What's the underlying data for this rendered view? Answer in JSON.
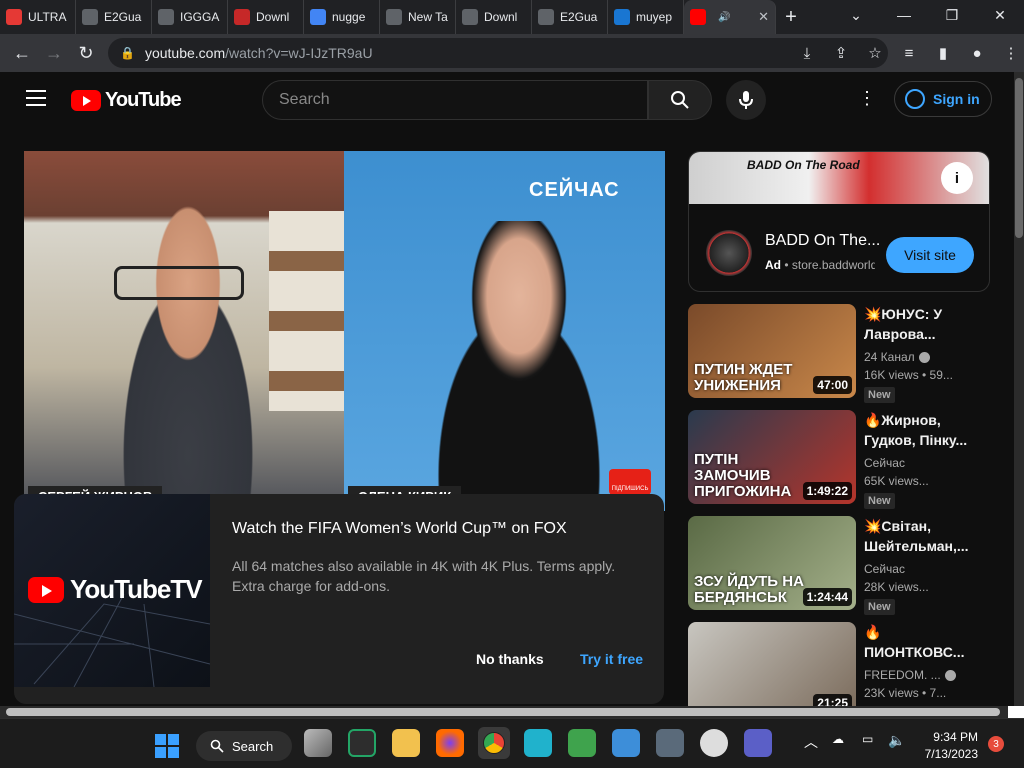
{
  "browser": {
    "tabs": [
      {
        "label": "ULTRA",
        "favicon_color": "#e53935",
        "active": false
      },
      {
        "label": "E2Gua",
        "favicon_color": "#5f6368",
        "active": false
      },
      {
        "label": "IGGGA",
        "favicon_color": "#5f6368",
        "active": false
      },
      {
        "label": "Downl",
        "favicon_color": "#c62828",
        "active": false
      },
      {
        "label": "nugge",
        "favicon_color": "#4285f4",
        "active": false
      },
      {
        "label": "New Ta",
        "favicon_color": "#5f6368",
        "active": false
      },
      {
        "label": "Downl",
        "favicon_color": "#5f6368",
        "active": false
      },
      {
        "label": "E2Gua",
        "favicon_color": "#5f6368",
        "active": false
      },
      {
        "label": "muyep",
        "favicon_color": "#1976d2",
        "active": false
      },
      {
        "label": "",
        "favicon_color": "#ff0000",
        "active": true
      }
    ],
    "new_tab_label": "+",
    "url": "youtube.com/watch?v=wJ-IJzTR9aU",
    "url_host": "youtube.com",
    "url_path": "/watch?v=wJ-IJzTR9aU"
  },
  "youtube": {
    "logo_text": "YouTube",
    "search_placeholder": "Search",
    "sign_in_label": "Sign in"
  },
  "player": {
    "overlay_word": "СЕЙЧАС",
    "left_name": "СЕРГЕЙ ЖИРНОВ",
    "right_name": "ОЛЕНА КИРИК",
    "subscribe_caption": "ПІДПИШИСЬ"
  },
  "promo": {
    "logo_text": "YouTubeTV",
    "title": "Watch the FIFA Women’s World Cup™ on FOX",
    "description": "All 64 matches also available in 4K with 4K Plus. Terms apply. Extra charge for add-ons.",
    "no_thanks_label": "No thanks",
    "try_label": "Try it free"
  },
  "ad": {
    "banner_text": "BADD On The Road",
    "title": "BADD On The...",
    "ad_label": "Ad",
    "domain": "store.baddworld",
    "visit_label": "Visit site",
    "info_glyph": "i"
  },
  "recommendations": [
    {
      "title": "💥ЮНУС: У Лаврова...",
      "channel": "24 Канал",
      "verified": true,
      "views": "16K views • 59...",
      "badge": "New",
      "duration": "47:00",
      "thumb_caption": "ПУТИН ЖДЕТ УНИЖЕНИЯ",
      "thumb_colors": [
        "#7a4a2a",
        "#c9884a"
      ]
    },
    {
      "title": "🔥Жирнов, Гудков, Пінку...",
      "channel": "Сейчас",
      "verified": false,
      "views": "65K views...",
      "badge": "New",
      "duration": "1:49:22",
      "thumb_caption": "ПУТІН ЗАМОЧИВ ПРИГОЖИНА",
      "thumb_colors": [
        "#2a3a4e",
        "#b5352b"
      ]
    },
    {
      "title": "💥Світан, Шейтельман,...",
      "channel": "Сейчас",
      "verified": false,
      "views": "28K views...",
      "badge": "New",
      "duration": "1:24:44",
      "thumb_caption": "ЗСУ ЙДУТЬ НА БЕРДЯНСЬК",
      "thumb_colors": [
        "#5a6a45",
        "#a4b08a"
      ]
    },
    {
      "title": "🔥ПИОНТКОВС...",
      "channel": "FREEDOM. ...",
      "verified": true,
      "views": "23K views • 7...",
      "badge": "",
      "duration": "21:25",
      "thumb_caption": "",
      "thumb_colors": [
        "#c8c6c0",
        "#7a6a5a"
      ]
    }
  ],
  "taskbar": {
    "search_label": "Search",
    "time": "9:34 PM",
    "date": "7/13/2023",
    "notification_count": "3"
  }
}
